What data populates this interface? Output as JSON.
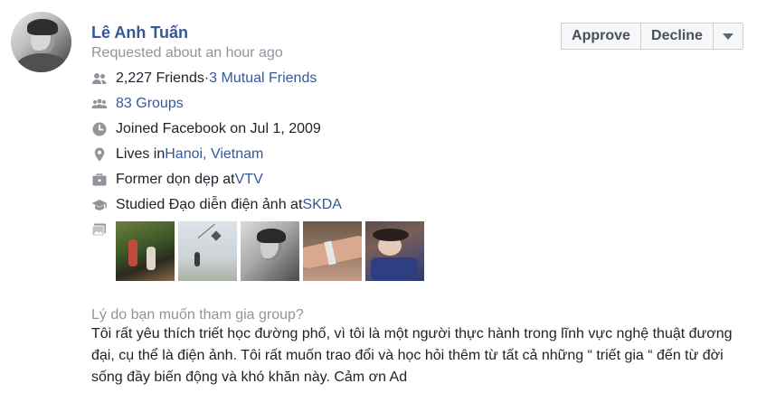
{
  "profile": {
    "name": "Lê Anh Tuấn",
    "requested": "Requested about an hour ago"
  },
  "actions": {
    "approve_label": "Approve",
    "decline_label": "Decline",
    "more_icon": "caret-down-icon"
  },
  "info": {
    "friends_count": "2,227 Friends",
    "friends_separator": " · ",
    "mutual_friends": "3 Mutual Friends",
    "groups": "83 Groups",
    "joined": "Joined Facebook on Jul 1, 2009",
    "lives_prefix": "Lives in ",
    "lives_place": "Hanoi, Vietnam",
    "work_prefix": "Former dọn dẹp at ",
    "work_place": "VTV",
    "study_prefix": "Studied Đạo diễn điện ảnh at ",
    "study_place": "SKDA"
  },
  "icons": [
    "friends-icon",
    "groups-icon",
    "clock-icon",
    "location-pin-icon",
    "briefcase-icon",
    "graduation-cap-icon",
    "photo-icon"
  ],
  "colors": {
    "link": "#365899",
    "muted": "#90949c",
    "text": "#1d2129"
  },
  "question": {
    "label": "Lý do bạn muốn tham gia group?",
    "answer": "Tôi rất yêu thích triết học đường phố, vì tôi là một người thực hành trong lĩnh vực nghệ thuật đương đại, cụ thể là điện ảnh. Tôi rất muốn trao đổi và học hỏi thêm từ tất cả những “ triết gia “ đến từ đời sống đầy biến động và khó khăn này. Cảm ơn Ad"
  }
}
